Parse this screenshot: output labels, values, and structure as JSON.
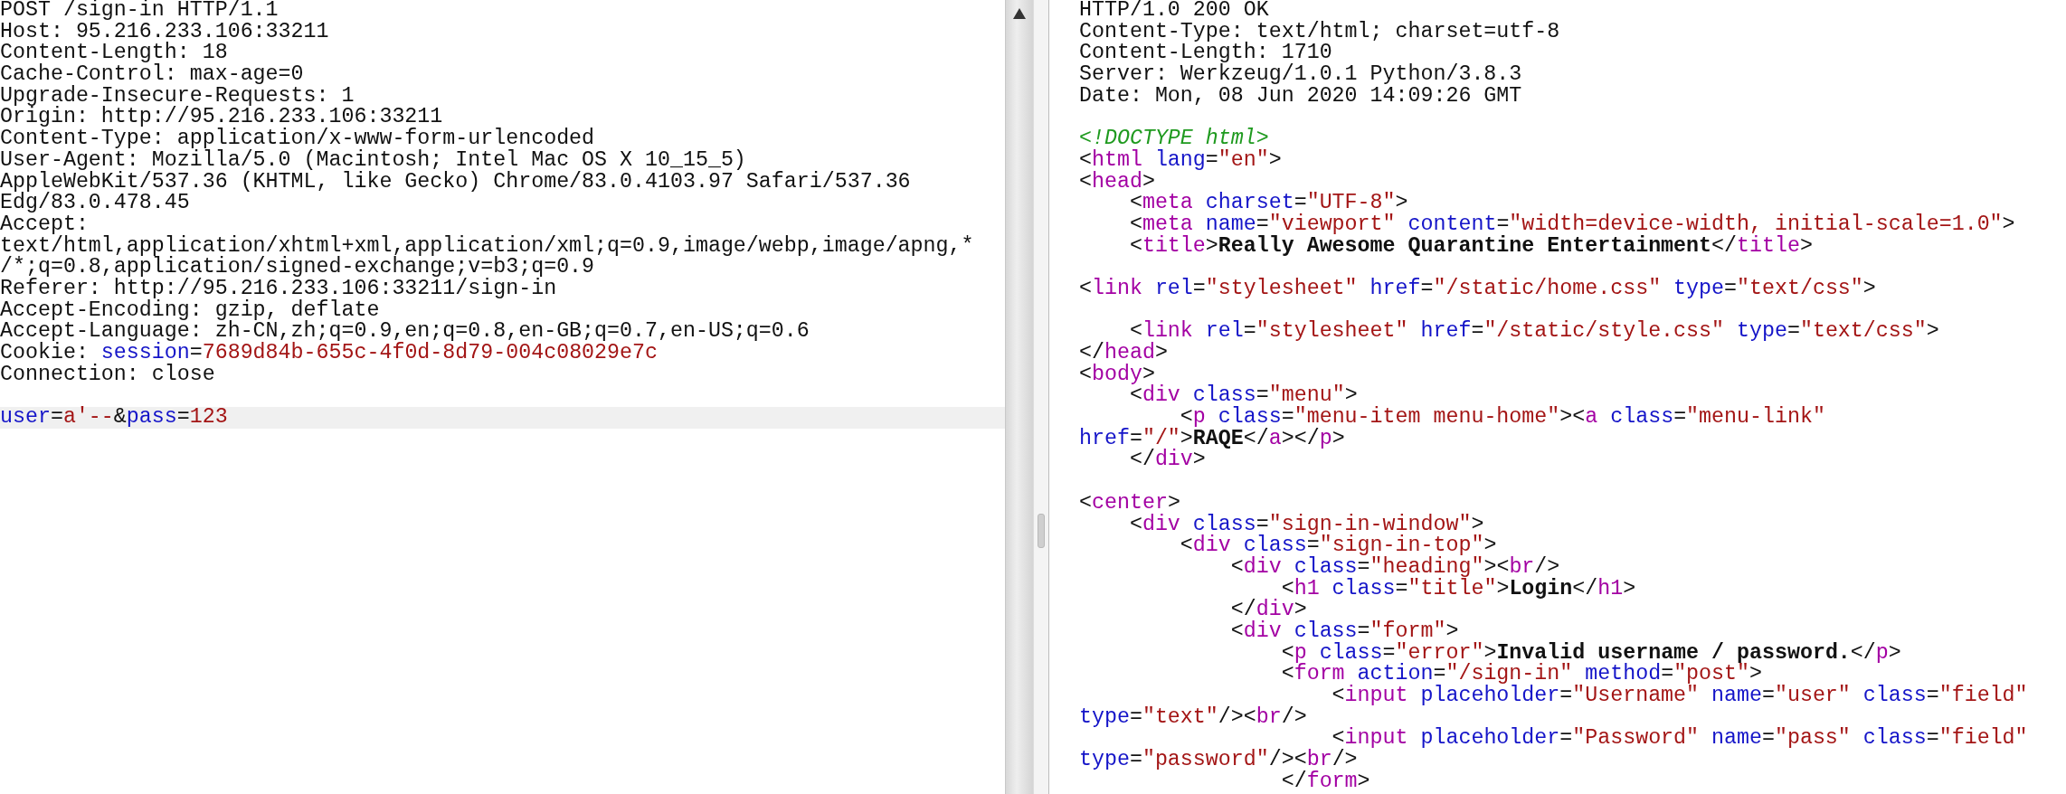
{
  "request": {
    "header_lines": [
      {
        "segments": [
          {
            "kind": "plain",
            "text": "POST /sign-in HTTP/1.1"
          }
        ]
      },
      {
        "segments": [
          {
            "kind": "plain",
            "text": "Host: 95.216.233.106:33211"
          }
        ]
      },
      {
        "segments": [
          {
            "kind": "plain",
            "text": "Content-Length: 18"
          }
        ]
      },
      {
        "segments": [
          {
            "kind": "plain",
            "text": "Cache-Control: max-age=0"
          }
        ]
      },
      {
        "segments": [
          {
            "kind": "plain",
            "text": "Upgrade-Insecure-Requests: 1"
          }
        ]
      },
      {
        "segments": [
          {
            "kind": "plain",
            "text": "Origin: http://95.216.233.106:33211"
          }
        ]
      },
      {
        "segments": [
          {
            "kind": "plain",
            "text": "Content-Type: application/x-www-form-urlencoded"
          }
        ]
      },
      {
        "segments": [
          {
            "kind": "plain",
            "text": "User-Agent: Mozilla/5.0 (Macintosh; Intel Mac OS X 10_15_5)"
          }
        ]
      },
      {
        "segments": [
          {
            "kind": "plain",
            "text": "AppleWebKit/537.36 (KHTML, like Gecko) Chrome/83.0.4103.97 Safari/537.36"
          }
        ]
      },
      {
        "segments": [
          {
            "kind": "plain",
            "text": "Edg/83.0.478.45"
          }
        ]
      },
      {
        "segments": [
          {
            "kind": "plain",
            "text": "Accept:"
          }
        ]
      },
      {
        "segments": [
          {
            "kind": "plain",
            "text": "text/html,application/xhtml+xml,application/xml;q=0.9,image/webp,image/apng,*"
          }
        ]
      },
      {
        "segments": [
          {
            "kind": "plain",
            "text": "/*;q=0.8,application/signed-exchange;v=b3;q=0.9"
          }
        ]
      },
      {
        "segments": [
          {
            "kind": "plain",
            "text": "Referer: http://95.216.233.106:33211/sign-in"
          }
        ]
      },
      {
        "segments": [
          {
            "kind": "plain",
            "text": "Accept-Encoding: gzip, deflate"
          }
        ]
      },
      {
        "segments": [
          {
            "kind": "plain",
            "text": "Accept-Language: zh-CN,zh;q=0.9,en;q=0.8,en-GB;q=0.7,en-US;q=0.6"
          }
        ]
      },
      {
        "segments": [
          {
            "kind": "plain",
            "text": "Cookie: "
          },
          {
            "kind": "name",
            "text": "session"
          },
          {
            "kind": "plain",
            "text": "="
          },
          {
            "kind": "value",
            "text": "7689d84b-655c-4f0d-8d79-004c08029e7c"
          }
        ]
      },
      {
        "segments": [
          {
            "kind": "plain",
            "text": "Connection: close"
          }
        ]
      },
      {
        "kind": "blank"
      }
    ],
    "body_line": {
      "current": true,
      "segments": [
        {
          "kind": "name",
          "text": "user"
        },
        {
          "kind": "plain",
          "text": "="
        },
        {
          "kind": "value",
          "text": "a'--"
        },
        {
          "kind": "plain",
          "text": "&"
        },
        {
          "kind": "name",
          "text": "pass"
        },
        {
          "kind": "plain",
          "text": "="
        },
        {
          "kind": "value",
          "text": "123"
        }
      ]
    }
  },
  "response": {
    "lines": [
      {
        "segments": [
          {
            "kind": "plain",
            "text": "HTTP/1.0 200 OK"
          }
        ]
      },
      {
        "segments": [
          {
            "kind": "plain",
            "text": "Content-Type: text/html; charset=utf-8"
          }
        ]
      },
      {
        "segments": [
          {
            "kind": "plain",
            "text": "Content-Length: 1710"
          }
        ]
      },
      {
        "segments": [
          {
            "kind": "plain",
            "text": "Server: Werkzeug/1.0.1 Python/3.8.3"
          }
        ]
      },
      {
        "segments": [
          {
            "kind": "plain",
            "text": "Date: Mon, 08 Jun 2020 14:09:26 GMT"
          }
        ]
      },
      {
        "kind": "blank"
      },
      {
        "segments": [
          {
            "kind": "doctype",
            "text": "<!DOCTYPE html>"
          }
        ]
      },
      {
        "segments": [
          {
            "kind": "plain",
            "text": "<"
          },
          {
            "kind": "tag",
            "text": "html"
          },
          {
            "kind": "name",
            "text": " lang"
          },
          {
            "kind": "plain",
            "text": "="
          },
          {
            "kind": "value",
            "text": "\"en\""
          },
          {
            "kind": "plain",
            "text": ">"
          }
        ]
      },
      {
        "segments": [
          {
            "kind": "plain",
            "text": "<"
          },
          {
            "kind": "tag",
            "text": "head"
          },
          {
            "kind": "plain",
            "text": ">"
          }
        ]
      },
      {
        "segments": [
          {
            "kind": "plain",
            "text": "    <"
          },
          {
            "kind": "tag",
            "text": "meta"
          },
          {
            "kind": "name",
            "text": " charset"
          },
          {
            "kind": "plain",
            "text": "="
          },
          {
            "kind": "value",
            "text": "\"UTF-8\""
          },
          {
            "kind": "plain",
            "text": ">"
          }
        ]
      },
      {
        "segments": [
          {
            "kind": "plain",
            "text": "    <"
          },
          {
            "kind": "tag",
            "text": "meta"
          },
          {
            "kind": "name",
            "text": " name"
          },
          {
            "kind": "plain",
            "text": "="
          },
          {
            "kind": "value",
            "text": "\"viewport\""
          },
          {
            "kind": "name",
            "text": " content"
          },
          {
            "kind": "plain",
            "text": "="
          },
          {
            "kind": "value",
            "text": "\"width=device-width, initial-scale=1.0\""
          },
          {
            "kind": "plain",
            "text": ">"
          }
        ]
      },
      {
        "segments": [
          {
            "kind": "plain",
            "text": "    <"
          },
          {
            "kind": "tag",
            "text": "title"
          },
          {
            "kind": "plain",
            "text": ">"
          },
          {
            "kind": "bold",
            "text": "Really Awesome Quarantine Entertainment"
          },
          {
            "kind": "plain",
            "text": "</"
          },
          {
            "kind": "tag",
            "text": "title"
          },
          {
            "kind": "plain",
            "text": ">"
          }
        ]
      },
      {
        "kind": "blank"
      },
      {
        "segments": [
          {
            "kind": "plain",
            "text": "<"
          },
          {
            "kind": "tag",
            "text": "link"
          },
          {
            "kind": "name",
            "text": " rel"
          },
          {
            "kind": "plain",
            "text": "="
          },
          {
            "kind": "value",
            "text": "\"stylesheet\""
          },
          {
            "kind": "name",
            "text": " href"
          },
          {
            "kind": "plain",
            "text": "="
          },
          {
            "kind": "value",
            "text": "\"/static/home.css\""
          },
          {
            "kind": "name",
            "text": " type"
          },
          {
            "kind": "plain",
            "text": "="
          },
          {
            "kind": "value",
            "text": "\"text/css\""
          },
          {
            "kind": "plain",
            "text": ">"
          }
        ]
      },
      {
        "kind": "blank"
      },
      {
        "segments": [
          {
            "kind": "plain",
            "text": "    <"
          },
          {
            "kind": "tag",
            "text": "link"
          },
          {
            "kind": "name",
            "text": " rel"
          },
          {
            "kind": "plain",
            "text": "="
          },
          {
            "kind": "value",
            "text": "\"stylesheet\""
          },
          {
            "kind": "name",
            "text": " href"
          },
          {
            "kind": "plain",
            "text": "="
          },
          {
            "kind": "value",
            "text": "\"/static/style.css\""
          },
          {
            "kind": "name",
            "text": " type"
          },
          {
            "kind": "plain",
            "text": "="
          },
          {
            "kind": "value",
            "text": "\"text/css\""
          },
          {
            "kind": "plain",
            "text": ">"
          }
        ]
      },
      {
        "segments": [
          {
            "kind": "plain",
            "text": "</"
          },
          {
            "kind": "tag",
            "text": "head"
          },
          {
            "kind": "plain",
            "text": ">"
          }
        ]
      },
      {
        "segments": [
          {
            "kind": "plain",
            "text": "<"
          },
          {
            "kind": "tag",
            "text": "body"
          },
          {
            "kind": "plain",
            "text": ">"
          }
        ]
      },
      {
        "segments": [
          {
            "kind": "plain",
            "text": "    <"
          },
          {
            "kind": "tag",
            "text": "div"
          },
          {
            "kind": "name",
            "text": " class"
          },
          {
            "kind": "plain",
            "text": "="
          },
          {
            "kind": "value",
            "text": "\"menu\""
          },
          {
            "kind": "plain",
            "text": ">"
          }
        ]
      },
      {
        "segments": [
          {
            "kind": "plain",
            "text": "        <"
          },
          {
            "kind": "tag",
            "text": "p"
          },
          {
            "kind": "name",
            "text": " class"
          },
          {
            "kind": "plain",
            "text": "="
          },
          {
            "kind": "value",
            "text": "\"menu-item menu-home\""
          },
          {
            "kind": "plain",
            "text": "><"
          },
          {
            "kind": "tag",
            "text": "a"
          },
          {
            "kind": "name",
            "text": " class"
          },
          {
            "kind": "plain",
            "text": "="
          },
          {
            "kind": "value",
            "text": "\"menu-link\""
          }
        ]
      },
      {
        "segments": [
          {
            "kind": "name",
            "text": "href"
          },
          {
            "kind": "plain",
            "text": "="
          },
          {
            "kind": "value",
            "text": "\"/\""
          },
          {
            "kind": "plain",
            "text": ">"
          },
          {
            "kind": "bold",
            "text": "RAQE"
          },
          {
            "kind": "plain",
            "text": "</"
          },
          {
            "kind": "tag",
            "text": "a"
          },
          {
            "kind": "plain",
            "text": "></"
          },
          {
            "kind": "tag",
            "text": "p"
          },
          {
            "kind": "plain",
            "text": ">"
          }
        ]
      },
      {
        "segments": [
          {
            "kind": "plain",
            "text": "    </"
          },
          {
            "kind": "tag",
            "text": "div"
          },
          {
            "kind": "plain",
            "text": ">"
          }
        ]
      },
      {
        "kind": "blank"
      },
      {
        "segments": [
          {
            "kind": "plain",
            "text": "<"
          },
          {
            "kind": "tag",
            "text": "center"
          },
          {
            "kind": "plain",
            "text": ">"
          }
        ]
      },
      {
        "segments": [
          {
            "kind": "plain",
            "text": "    <"
          },
          {
            "kind": "tag",
            "text": "div"
          },
          {
            "kind": "name",
            "text": " class"
          },
          {
            "kind": "plain",
            "text": "="
          },
          {
            "kind": "value",
            "text": "\"sign-in-window\""
          },
          {
            "kind": "plain",
            "text": ">"
          }
        ]
      },
      {
        "segments": [
          {
            "kind": "plain",
            "text": "        <"
          },
          {
            "kind": "tag",
            "text": "div"
          },
          {
            "kind": "name",
            "text": " class"
          },
          {
            "kind": "plain",
            "text": "="
          },
          {
            "kind": "value",
            "text": "\"sign-in-top\""
          },
          {
            "kind": "plain",
            "text": ">"
          }
        ]
      },
      {
        "segments": [
          {
            "kind": "plain",
            "text": "            <"
          },
          {
            "kind": "tag",
            "text": "div"
          },
          {
            "kind": "name",
            "text": " class"
          },
          {
            "kind": "plain",
            "text": "="
          },
          {
            "kind": "value",
            "text": "\"heading\""
          },
          {
            "kind": "plain",
            "text": "><"
          },
          {
            "kind": "tag",
            "text": "br"
          },
          {
            "kind": "plain",
            "text": "/>"
          }
        ]
      },
      {
        "segments": [
          {
            "kind": "plain",
            "text": "                <"
          },
          {
            "kind": "tag",
            "text": "h1"
          },
          {
            "kind": "name",
            "text": " class"
          },
          {
            "kind": "plain",
            "text": "="
          },
          {
            "kind": "value",
            "text": "\"title\""
          },
          {
            "kind": "plain",
            "text": ">"
          },
          {
            "kind": "bold",
            "text": "Login"
          },
          {
            "kind": "plain",
            "text": "</"
          },
          {
            "kind": "tag",
            "text": "h1"
          },
          {
            "kind": "plain",
            "text": ">"
          }
        ]
      },
      {
        "segments": [
          {
            "kind": "plain",
            "text": "            </"
          },
          {
            "kind": "tag",
            "text": "div"
          },
          {
            "kind": "plain",
            "text": ">"
          }
        ]
      },
      {
        "segments": [
          {
            "kind": "plain",
            "text": "            <"
          },
          {
            "kind": "tag",
            "text": "div"
          },
          {
            "kind": "name",
            "text": " class"
          },
          {
            "kind": "plain",
            "text": "="
          },
          {
            "kind": "value",
            "text": "\"form\""
          },
          {
            "kind": "plain",
            "text": ">"
          }
        ]
      },
      {
        "segments": [
          {
            "kind": "plain",
            "text": "                <"
          },
          {
            "kind": "tag",
            "text": "p"
          },
          {
            "kind": "name",
            "text": " class"
          },
          {
            "kind": "plain",
            "text": "="
          },
          {
            "kind": "value",
            "text": "\"error\""
          },
          {
            "kind": "plain",
            "text": ">"
          },
          {
            "kind": "bold",
            "text": "Invalid username / password."
          },
          {
            "kind": "plain",
            "text": "</"
          },
          {
            "kind": "tag",
            "text": "p"
          },
          {
            "kind": "plain",
            "text": ">"
          }
        ]
      },
      {
        "segments": [
          {
            "kind": "plain",
            "text": "                <"
          },
          {
            "kind": "tag",
            "text": "form"
          },
          {
            "kind": "name",
            "text": " action"
          },
          {
            "kind": "plain",
            "text": "="
          },
          {
            "kind": "value",
            "text": "\"/sign-in\""
          },
          {
            "kind": "name",
            "text": " method"
          },
          {
            "kind": "plain",
            "text": "="
          },
          {
            "kind": "value",
            "text": "\"post\""
          },
          {
            "kind": "plain",
            "text": ">"
          }
        ]
      },
      {
        "segments": [
          {
            "kind": "plain",
            "text": "                    <"
          },
          {
            "kind": "tag",
            "text": "input"
          },
          {
            "kind": "name",
            "text": " placeholder"
          },
          {
            "kind": "plain",
            "text": "="
          },
          {
            "kind": "value",
            "text": "\"Username\""
          },
          {
            "kind": "name",
            "text": " name"
          },
          {
            "kind": "plain",
            "text": "="
          },
          {
            "kind": "value",
            "text": "\"user\""
          },
          {
            "kind": "name",
            "text": " class"
          },
          {
            "kind": "plain",
            "text": "="
          },
          {
            "kind": "value",
            "text": "\"field\""
          }
        ]
      },
      {
        "segments": [
          {
            "kind": "name",
            "text": "type"
          },
          {
            "kind": "plain",
            "text": "="
          },
          {
            "kind": "value",
            "text": "\"text\""
          },
          {
            "kind": "plain",
            "text": "/><"
          },
          {
            "kind": "tag",
            "text": "br"
          },
          {
            "kind": "plain",
            "text": "/>"
          }
        ]
      },
      {
        "segments": [
          {
            "kind": "plain",
            "text": "                    <"
          },
          {
            "kind": "tag",
            "text": "input"
          },
          {
            "kind": "name",
            "text": " placeholder"
          },
          {
            "kind": "plain",
            "text": "="
          },
          {
            "kind": "value",
            "text": "\"Password\""
          },
          {
            "kind": "name",
            "text": " name"
          },
          {
            "kind": "plain",
            "text": "="
          },
          {
            "kind": "value",
            "text": "\"pass\""
          },
          {
            "kind": "name",
            "text": " class"
          },
          {
            "kind": "plain",
            "text": "="
          },
          {
            "kind": "value",
            "text": "\"field\""
          }
        ]
      },
      {
        "segments": [
          {
            "kind": "name",
            "text": "type"
          },
          {
            "kind": "plain",
            "text": "="
          },
          {
            "kind": "value",
            "text": "\"password\""
          },
          {
            "kind": "plain",
            "text": "/><"
          },
          {
            "kind": "tag",
            "text": "br"
          },
          {
            "kind": "plain",
            "text": "/>"
          }
        ]
      },
      {
        "segments": [
          {
            "kind": "plain",
            "text": "                </"
          },
          {
            "kind": "tag",
            "text": "form"
          },
          {
            "kind": "plain",
            "text": ">"
          }
        ]
      }
    ]
  }
}
